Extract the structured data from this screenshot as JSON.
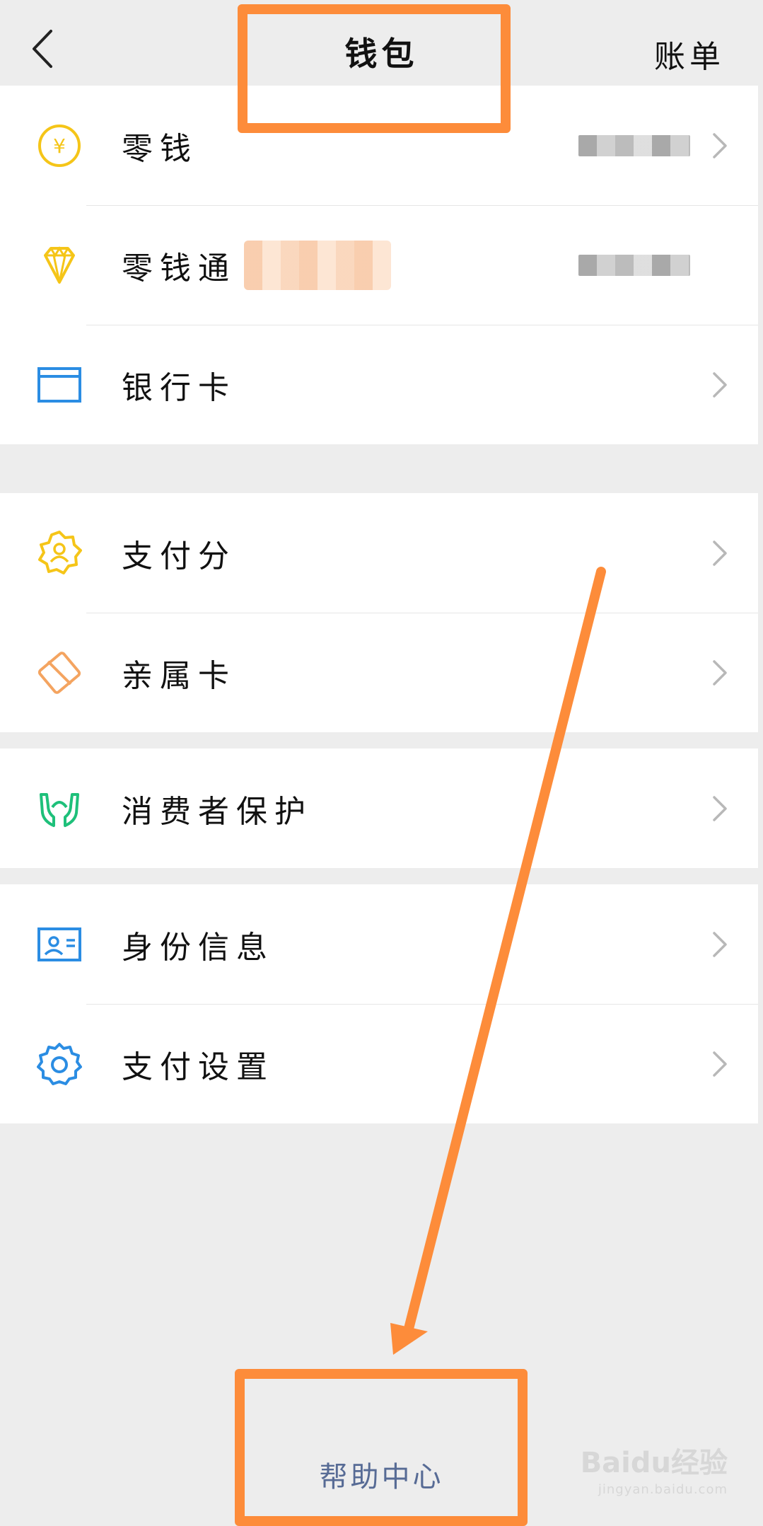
{
  "header": {
    "title": "钱包",
    "right_action": "账单"
  },
  "groups": [
    {
      "items": [
        {
          "label": "零钱",
          "icon": "yuan-coin-icon"
        },
        {
          "label": "零钱通",
          "icon": "diamond-icon"
        },
        {
          "label": "银行卡",
          "icon": "bank-card-icon"
        }
      ]
    },
    {
      "items": [
        {
          "label": "支付分",
          "icon": "pay-score-badge-icon"
        },
        {
          "label": "亲属卡",
          "icon": "family-card-icon"
        }
      ]
    },
    {
      "items": [
        {
          "label": "消费者保护",
          "icon": "hands-protect-icon"
        }
      ]
    },
    {
      "items": [
        {
          "label": "身份信息",
          "icon": "id-card-icon"
        },
        {
          "label": "支付设置",
          "icon": "settings-gear-icon"
        }
      ]
    }
  ],
  "footer": {
    "help_center": "帮助中心"
  },
  "watermark": {
    "brand": "Baidu经验",
    "url": "jingyan.baidu.com"
  },
  "colors": {
    "annotation": "#fd8c3a",
    "link": "#576b95",
    "yellow": "#f5c518",
    "blue": "#2b8de3",
    "green": "#1ec07a",
    "orange": "#f4a460"
  }
}
